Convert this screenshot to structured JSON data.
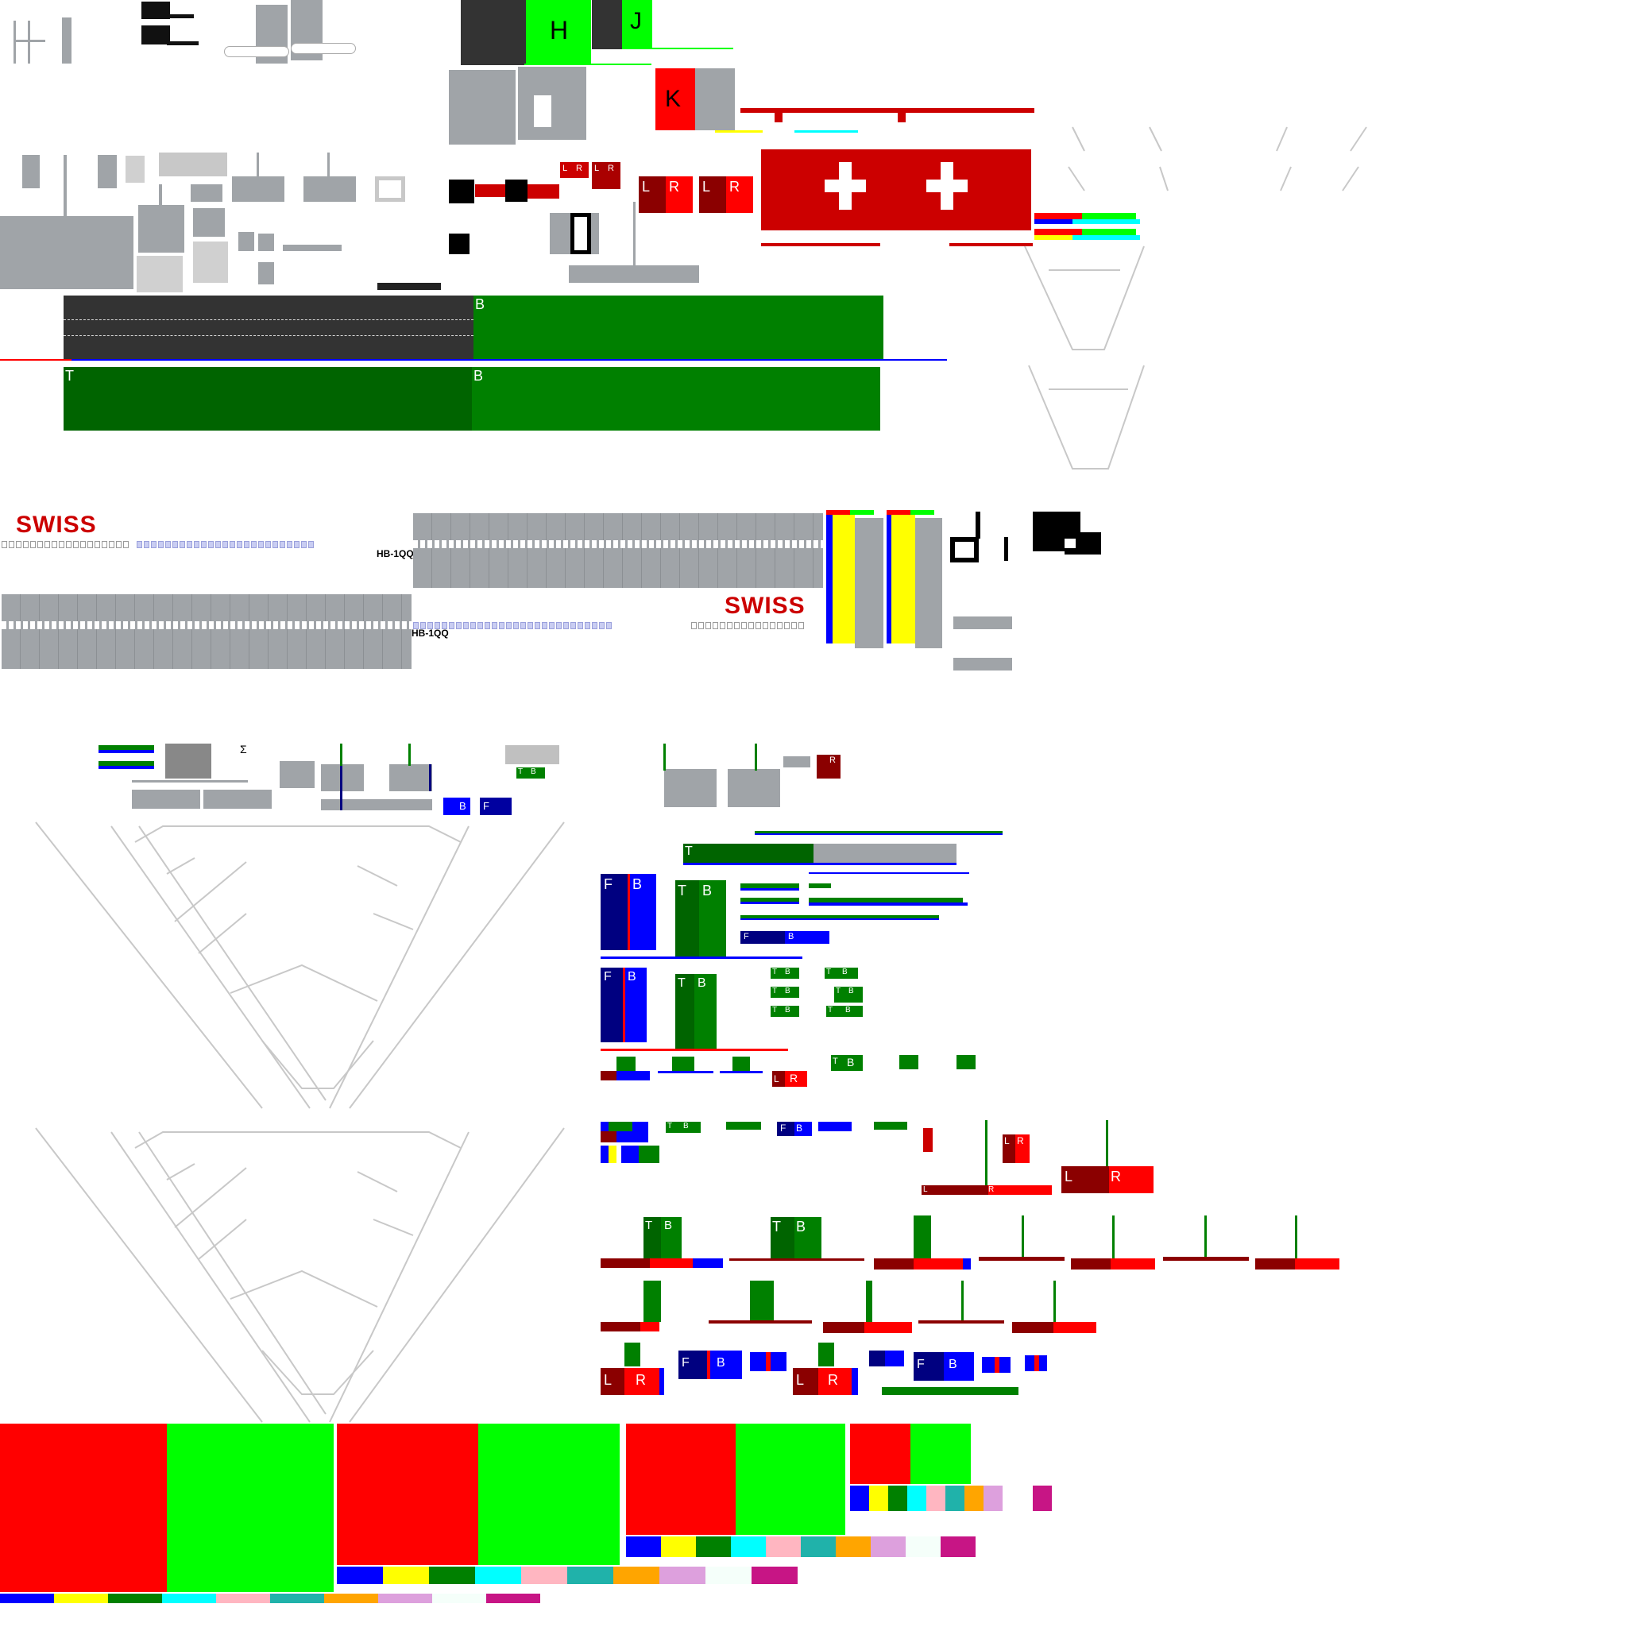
{
  "atlas": {
    "letters": {
      "h": "H",
      "j": "J",
      "k": "K"
    },
    "runway": {
      "label_b1": "B",
      "label_t": "T",
      "label_b2": "B"
    },
    "fuselage": {
      "brand_top": "SWISS",
      "reg_top": "HB-1QQ",
      "brand_bottom": "SWISS",
      "reg_bottom": "HB-1QQ"
    },
    "lr_pairs": {
      "l": "L",
      "r": "R"
    },
    "tb_pairs": {
      "t": "T",
      "b": "B"
    },
    "fb_pairs": {
      "f": "F",
      "b": "B"
    },
    "sigma_text": "Σ"
  },
  "colors": {
    "swiss_red": "#d20000",
    "dark_red": "#8b0000",
    "green": "#008000",
    "dark_green": "#006400",
    "bright_green": "#00ff00",
    "red": "#ff0000",
    "blue": "#0000ff",
    "navy": "#000080",
    "grey": "#a0a4a8",
    "asphalt": "#333333"
  },
  "swatches_large": [
    "#0000ff",
    "#ffff00",
    "#008000",
    "#00ffff",
    "#ffb6c1",
    "#20b2aa",
    "#ffa500",
    "#dda0dd",
    "#f5fffa",
    "#c71585"
  ],
  "swatches_small": [
    "#0000ff",
    "#ffff00",
    "#008000",
    "#00ffff",
    "#ffb6c1",
    "#20b2aa",
    "#ffa500",
    "#dda0dd",
    "#ffffff",
    "#c71585"
  ]
}
